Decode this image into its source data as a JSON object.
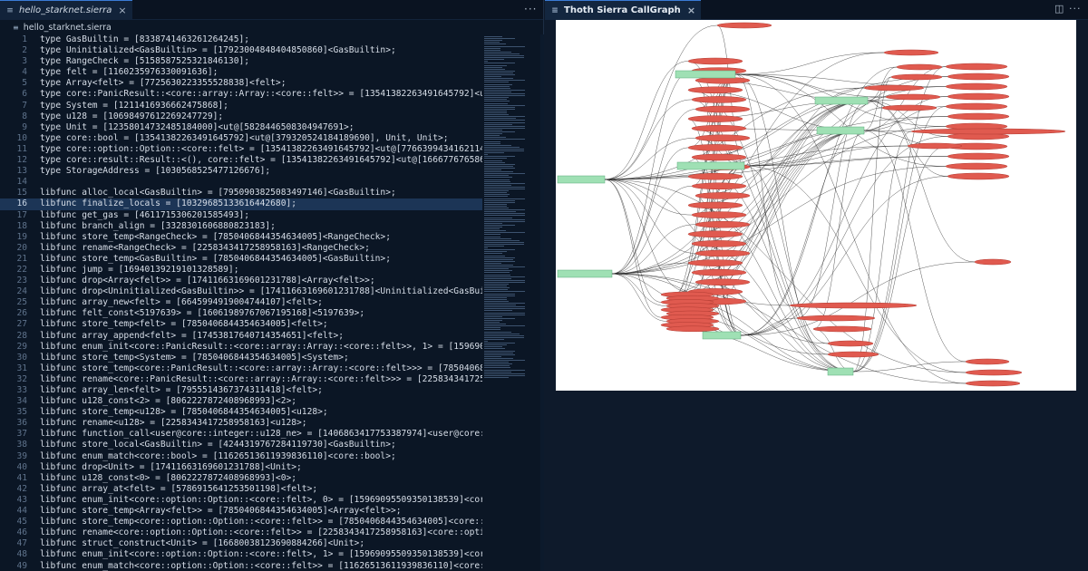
{
  "editor": {
    "tab_title": "hello_starknet.sierra",
    "breadcrumb": "hello_starknet.sierra",
    "selected_line": 16,
    "lines": [
      "type GasBuiltin = [8338741463261264245];",
      "type Uninitialized<GasBuiltin> = [17923004848404850860]<GasBuiltin>;",
      "type RangeCheck = [5158587525321846130];",
      "type felt = [1160235976330091636];",
      "type Array<felt> = [7725630223355528838]<felt>;",
      "type core::PanicResult::<core::array::Array::<core::felt>> = [13541382263491645792]<ut@[40",
      "type System = [1211416936662475868];",
      "type u128 = [10698497612269247729];",
      "type Unit = [12358014732485184000]<ut@[5828446508304947691>;",
      "type core::bool = [13541382263491645792]<ut@[379320524184189690], Unit, Unit>;",
      "type core::option::Option::<core::felt> = [13541382263491645792]<ut@[776639943416211479]",
      "type core::result::Result::<(), core::felt> = [13541382263491645792]<ut@[166677676586324",
      "type StorageAddress = [1030568525477126676];",
      "",
      "libfunc alloc_local<GasBuiltin> = [7950903825083497146]<GasBuiltin>;",
      "libfunc finalize_locals = [10329685133616442680];",
      "libfunc get_gas = [4611715306201585493];",
      "libfunc branch_align = [3328301606880823183];",
      "libfunc store_temp<RangeCheck> = [7850406844354634005]<RangeCheck>;",
      "libfunc rename<RangeCheck> = [2258343417258958163]<RangeCheck>;",
      "libfunc store_temp<GasBuiltin> = [7850406844354634005]<GasBuiltin>;",
      "libfunc jump = [16940139219101328589];",
      "libfunc drop<Array<felt>> = [17411663169601231788]<Array<felt>>;",
      "libfunc drop<Uninitialized<GasBuiltin>> = [17411663169601231788]<Uninitialized<GasBuiltin",
      "libfunc array_new<felt> = [6645994919004744107]<felt>;",
      "libfunc felt_const<5197639> = [16061989767067195168]<5197639>;",
      "libfunc store_temp<felt> = [7850406844354634005]<felt>;",
      "libfunc array_append<felt> = [17453817640714354651]<felt>;",
      "libfunc enum_init<core::PanicResult::<core::array::Array::<core::felt>>, 1> = [1596909550",
      "libfunc store_temp<System> = [7850406844354634005]<System>;",
      "libfunc store_temp<core::PanicResult::<core::array::Array::<core::felt>>> = [785040684435",
      "libfunc rename<core::PanicResult::<core::array::Array::<core::felt>>> = [2258343417258958",
      "libfunc array_len<felt> = [7955514367374311418]<felt>;",
      "libfunc u128_const<2> = [8062227872408968993]<2>;",
      "libfunc store_temp<u128> = [7850406844354634005]<u128>;",
      "libfunc rename<u128> = [2258343417258958163]<u128>;",
      "libfunc function_call<user@core::integer::u128_ne> = [1406863417753387974]<user@core::int",
      "libfunc store_local<GasBuiltin> = [4244319767284119730]<GasBuiltin>;",
      "libfunc enum_match<core::bool> = [11626513611939836110]<core::bool>;",
      "libfunc drop<Unit> = [17411663169601231788]<Unit>;",
      "libfunc u128_const<0> = [8062227872408968993]<0>;",
      "libfunc array_at<felt> = [5786915641253501198]<felt>;",
      "libfunc enum_init<core::option::Option::<core::felt>, 0> = [15969095509350138539]<core::op",
      "libfunc store_temp<Array<felt>> = [7850406844354634005]<Array<felt>>;",
      "libfunc store_temp<core::option::Option::<core::felt>> = [7850406844354634005]<core::optic",
      "libfunc rename<core::option::Option::<core::felt>> = [2258343417258958163]<core::option::(",
      "libfunc struct_construct<Unit> = [16680038123690884266]<Unit>;",
      "libfunc enum_init<core::option::Option::<core::felt>, 1> = [15969095509350138539]<core::op",
      "libfunc enum_match<core::option::Option::<core::felt>> = [11626513611939836110]<core::opti"
    ]
  },
  "graph_panel": {
    "tab_title": "Thoth Sierra CallGraph",
    "split_icon": "split-editor-icon",
    "more_icon": "more-actions-icon"
  },
  "colors": {
    "selection": "#1c3556",
    "node_red": "#e05a4f",
    "node_green": "#9fe0b4",
    "edge": "#222222"
  }
}
